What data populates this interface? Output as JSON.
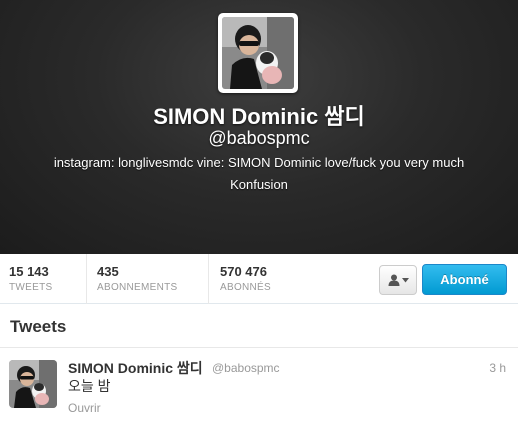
{
  "profile": {
    "name": "SIMON Dominic 쌈디",
    "handle": "@babospmc",
    "bio_line1": "instagram: longlivesmdc vine: SIMON Dominic love/fuck you very much",
    "bio_line2": "Konfusion"
  },
  "stats": [
    {
      "value": "15 143",
      "label": "TWEETS"
    },
    {
      "value": "435",
      "label": "ABONNEMENTS"
    },
    {
      "value": "570 476",
      "label": "ABONNÉS"
    }
  ],
  "actions": {
    "follow_label": "Abonné",
    "menu_icon": "user-icon"
  },
  "tweets_section": {
    "title": "Tweets"
  },
  "tweet": {
    "name": "SIMON Dominic 쌈디",
    "handle": "@babospmc",
    "time": "3 h",
    "text": "오늘 밤",
    "open_label": "Ouvrir"
  },
  "colors": {
    "follow_button": "#0ea0d8",
    "header_bg": "#2a2a2a",
    "muted_text": "#999999"
  }
}
